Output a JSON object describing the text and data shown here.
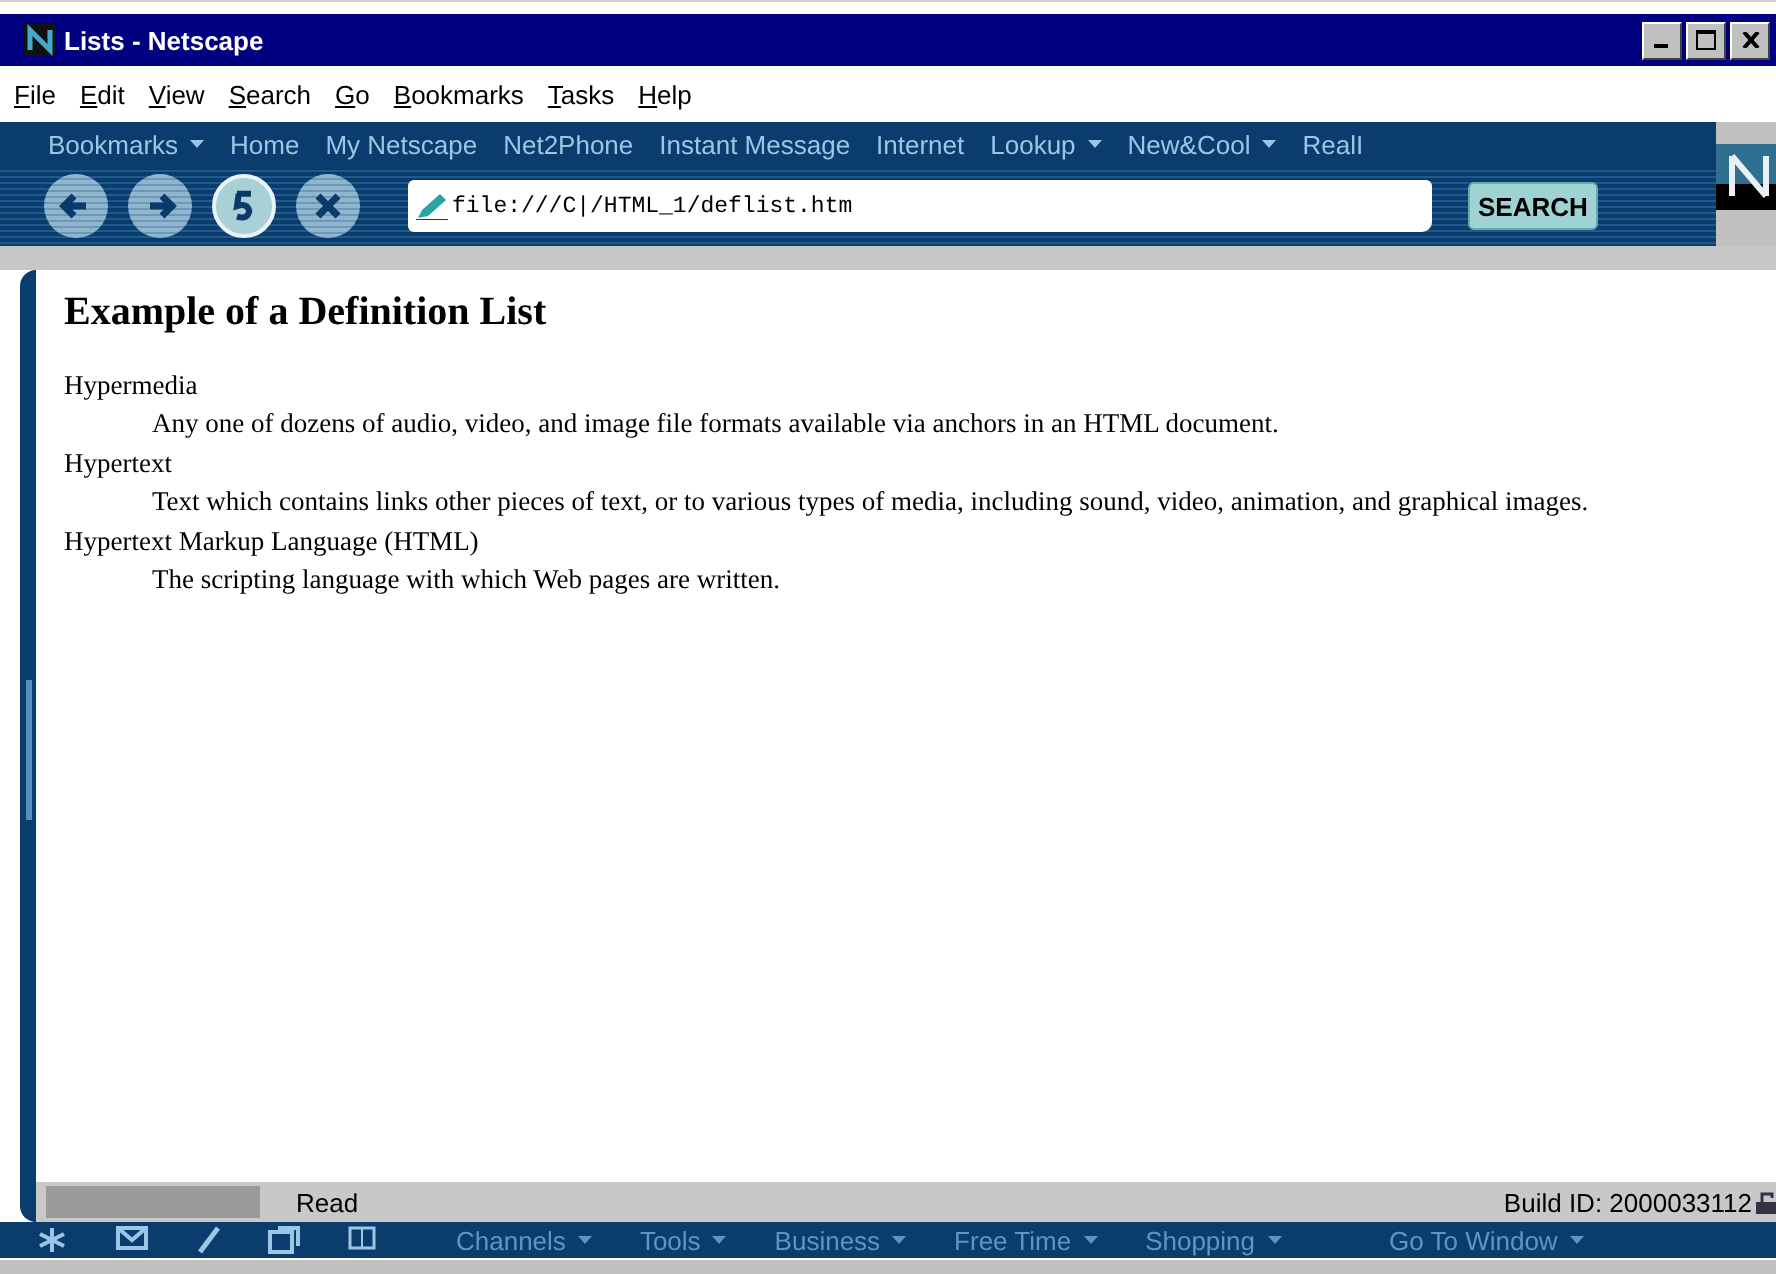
{
  "window": {
    "title": "Lists - Netscape"
  },
  "menu_bar": [
    "File",
    "Edit",
    "View",
    "Search",
    "Go",
    "Bookmarks",
    "Tasks",
    "Help"
  ],
  "personal_toolbar": [
    {
      "label": "Bookmarks",
      "dropdown": true
    },
    {
      "label": "Home",
      "dropdown": false
    },
    {
      "label": "My Netscape",
      "dropdown": false
    },
    {
      "label": "Net2Phone",
      "dropdown": false
    },
    {
      "label": "Instant Message",
      "dropdown": false
    },
    {
      "label": "Internet",
      "dropdown": false
    },
    {
      "label": "Lookup",
      "dropdown": true
    },
    {
      "label": "New&Cool",
      "dropdown": true
    },
    {
      "label": "RealI",
      "dropdown": false
    }
  ],
  "nav_buttons": [
    {
      "kind": "back",
      "disabled": true
    },
    {
      "kind": "forward",
      "disabled": true
    },
    {
      "kind": "reload",
      "disabled": false
    },
    {
      "kind": "stop",
      "disabled": true
    }
  ],
  "location": {
    "value": "file:///C|/HTML_1/deflist.htm"
  },
  "search_button": "SEARCH",
  "page": {
    "heading": "Example of a Definition List",
    "definitions": [
      {
        "term": "Hypermedia",
        "definition": "Any one of dozens of audio, video, and image file formats available via anchors in an HTML document."
      },
      {
        "term": "Hypertext",
        "definition": "Text which contains links other pieces of text, or to various types of media, including sound, video, animation, and graphical images."
      },
      {
        "term": "Hypertext Markup Language (HTML)",
        "definition": "The scripting language with which Web pages are written."
      }
    ]
  },
  "status_bar": {
    "progress": "Read",
    "build": "Build ID: 2000033112"
  },
  "taskbar": {
    "menus": [
      {
        "label": "Channels"
      },
      {
        "label": "Tools"
      },
      {
        "label": "Business"
      },
      {
        "label": "Free Time"
      },
      {
        "label": "Shopping"
      },
      {
        "label": "Go To Window"
      }
    ]
  }
}
